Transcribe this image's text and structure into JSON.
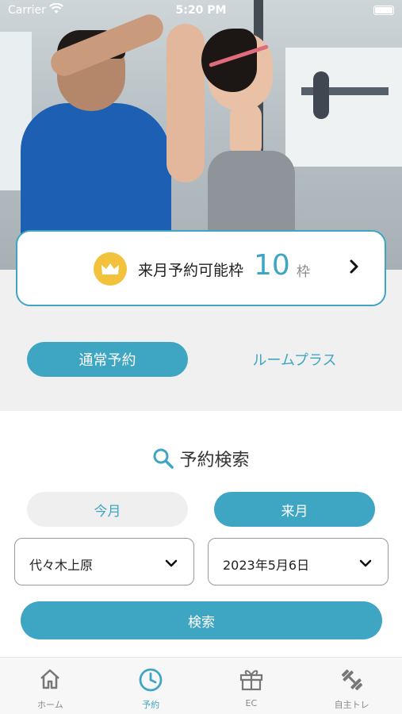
{
  "status_bar": {
    "carrier": "Carrier",
    "time": "5:20 PM"
  },
  "reservation_card": {
    "label": "来月予約可能枠",
    "count": "10",
    "unit": "枠"
  },
  "modes": {
    "normal": "通常予約",
    "room_plus": "ルームプラス"
  },
  "search": {
    "title": "予約検索",
    "this_month": "今月",
    "next_month": "来月",
    "store_value": "代々木上原",
    "date_value": "2023年5月6日",
    "button": "検索"
  },
  "tabs": [
    {
      "label": "ホーム",
      "icon": "home-icon",
      "active": false
    },
    {
      "label": "予約",
      "icon": "clock-icon",
      "active": true
    },
    {
      "label": "EC",
      "icon": "gift-box-icon",
      "active": false
    },
    {
      "label": "自主トレ",
      "icon": "dumbbell-icon",
      "active": false
    }
  ],
  "colors": {
    "accent": "#3ea5c3",
    "crown": "#f3c23c"
  }
}
